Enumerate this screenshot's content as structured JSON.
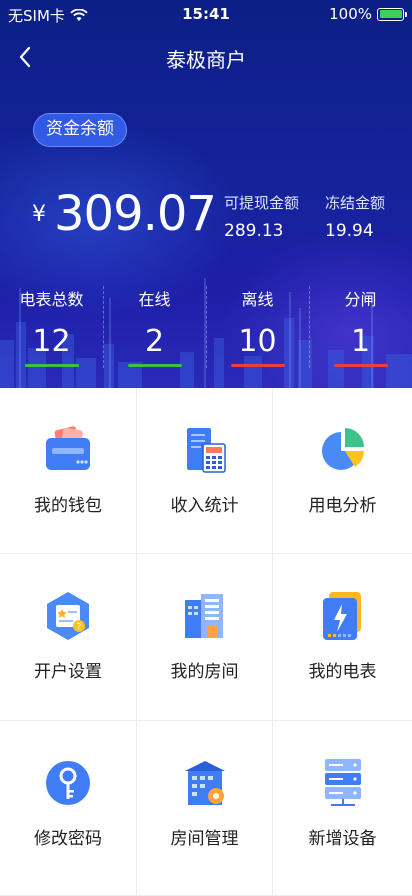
{
  "status_bar": {
    "carrier": "无SIM卡",
    "time": "15:41",
    "battery": "100%"
  },
  "nav": {
    "title": "泰极商户"
  },
  "balance": {
    "tag": "资金余额",
    "currency": "¥",
    "amount": "309.07",
    "withdrawable_label": "可提现金额",
    "withdrawable_value": "289.13",
    "frozen_label": "冻结金额",
    "frozen_value": "19.94"
  },
  "stats": [
    {
      "label": "电表总数",
      "value": "12",
      "color": "#3fbf3f"
    },
    {
      "label": "在线",
      "value": "2",
      "color": "#3fbf3f"
    },
    {
      "label": "离线",
      "value": "10",
      "color": "#e84040"
    },
    {
      "label": "分闸",
      "value": "1",
      "color": "#e84040"
    }
  ],
  "menu": [
    {
      "label": "我的钱包",
      "icon": "wallet-icon"
    },
    {
      "label": "收入统计",
      "icon": "calculator-icon"
    },
    {
      "label": "用电分析",
      "icon": "pie-chart-icon"
    },
    {
      "label": "开户设置",
      "icon": "account-settings-icon"
    },
    {
      "label": "我的房间",
      "icon": "building-icon"
    },
    {
      "label": "我的电表",
      "icon": "electric-meter-icon"
    },
    {
      "label": "修改密码",
      "icon": "key-icon"
    },
    {
      "label": "房间管理",
      "icon": "room-management-icon"
    },
    {
      "label": "新增设备",
      "icon": "server-icon"
    }
  ]
}
